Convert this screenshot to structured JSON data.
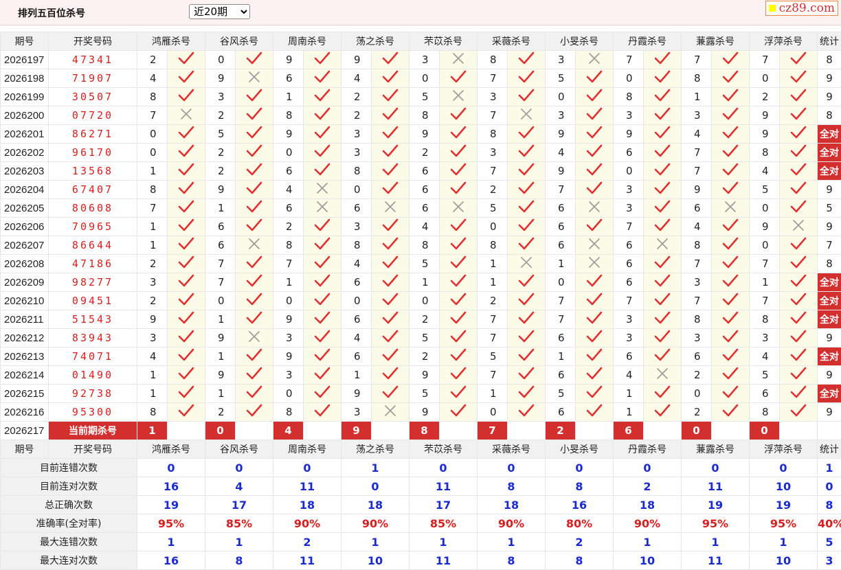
{
  "header": {
    "title": "排列五百位杀号",
    "range": "近20期",
    "logo": "cz89.com"
  },
  "cols": {
    "issue": "期号",
    "draw": "开奖号码",
    "stat": "统计"
  },
  "experts": [
    "鸿雁杀号",
    "谷风杀号",
    "周南杀号",
    "荡之杀号",
    "芣苡杀号",
    "采薇杀号",
    "小旻杀号",
    "丹霞杀号",
    "蒹露杀号",
    "浮萍杀号"
  ],
  "rows": [
    {
      "issue": "2026197",
      "draw": "47341",
      "kills": [
        2,
        0,
        9,
        9,
        3,
        8,
        3,
        7,
        7,
        7
      ],
      "ok": [
        1,
        1,
        1,
        1,
        0,
        1,
        0,
        1,
        1,
        1
      ],
      "total": "8"
    },
    {
      "issue": "2026198",
      "draw": "71907",
      "kills": [
        4,
        9,
        6,
        4,
        0,
        7,
        5,
        0,
        8,
        0
      ],
      "ok": [
        1,
        0,
        1,
        1,
        1,
        1,
        1,
        1,
        1,
        1
      ],
      "total": "9"
    },
    {
      "issue": "2026199",
      "draw": "30507",
      "kills": [
        8,
        3,
        1,
        2,
        5,
        3,
        0,
        8,
        1,
        2
      ],
      "ok": [
        1,
        1,
        1,
        1,
        0,
        1,
        1,
        1,
        1,
        1
      ],
      "total": "9"
    },
    {
      "issue": "2026200",
      "draw": "07720",
      "kills": [
        7,
        2,
        8,
        2,
        8,
        7,
        3,
        3,
        3,
        9
      ],
      "ok": [
        0,
        1,
        1,
        1,
        1,
        0,
        1,
        1,
        1,
        1
      ],
      "total": "8"
    },
    {
      "issue": "2026201",
      "draw": "86271",
      "kills": [
        0,
        5,
        9,
        3,
        9,
        8,
        9,
        9,
        4,
        9
      ],
      "ok": [
        1,
        1,
        1,
        1,
        1,
        1,
        1,
        1,
        1,
        1
      ],
      "total": "全对"
    },
    {
      "issue": "2026202",
      "draw": "96170",
      "kills": [
        0,
        2,
        0,
        3,
        2,
        3,
        4,
        6,
        7,
        8
      ],
      "ok": [
        1,
        1,
        1,
        1,
        1,
        1,
        1,
        1,
        1,
        1
      ],
      "total": "全对"
    },
    {
      "issue": "2026203",
      "draw": "13568",
      "kills": [
        1,
        2,
        6,
        8,
        6,
        7,
        9,
        0,
        7,
        4
      ],
      "ok": [
        1,
        1,
        1,
        1,
        1,
        1,
        1,
        1,
        1,
        1
      ],
      "total": "全对"
    },
    {
      "issue": "2026204",
      "draw": "67407",
      "kills": [
        8,
        9,
        4,
        0,
        6,
        2,
        7,
        3,
        9,
        5
      ],
      "ok": [
        1,
        1,
        0,
        1,
        1,
        1,
        1,
        1,
        1,
        1
      ],
      "total": "9"
    },
    {
      "issue": "2026205",
      "draw": "80608",
      "kills": [
        7,
        1,
        6,
        6,
        6,
        5,
        6,
        3,
        6,
        0
      ],
      "ok": [
        1,
        1,
        0,
        0,
        0,
        1,
        0,
        1,
        0,
        1
      ],
      "total": "5"
    },
    {
      "issue": "2026206",
      "draw": "70965",
      "kills": [
        1,
        6,
        2,
        3,
        4,
        0,
        6,
        7,
        4,
        9
      ],
      "ok": [
        1,
        1,
        1,
        1,
        1,
        1,
        1,
        1,
        1,
        0
      ],
      "total": "9"
    },
    {
      "issue": "2026207",
      "draw": "86644",
      "kills": [
        1,
        6,
        8,
        8,
        8,
        8,
        6,
        6,
        8,
        0
      ],
      "ok": [
        1,
        0,
        1,
        1,
        1,
        1,
        0,
        0,
        1,
        1
      ],
      "total": "7"
    },
    {
      "issue": "2026208",
      "draw": "47186",
      "kills": [
        2,
        7,
        7,
        4,
        5,
        1,
        1,
        6,
        7,
        7
      ],
      "ok": [
        1,
        1,
        1,
        1,
        1,
        0,
        0,
        1,
        1,
        1
      ],
      "total": "8"
    },
    {
      "issue": "2026209",
      "draw": "98277",
      "kills": [
        3,
        7,
        1,
        6,
        1,
        1,
        0,
        6,
        3,
        1
      ],
      "ok": [
        1,
        1,
        1,
        1,
        1,
        1,
        1,
        1,
        1,
        1
      ],
      "total": "全对"
    },
    {
      "issue": "2026210",
      "draw": "09451",
      "kills": [
        2,
        0,
        0,
        0,
        0,
        2,
        7,
        7,
        7,
        7
      ],
      "ok": [
        1,
        1,
        1,
        1,
        1,
        1,
        1,
        1,
        1,
        1
      ],
      "total": "全对"
    },
    {
      "issue": "2026211",
      "draw": "51543",
      "kills": [
        9,
        1,
        9,
        6,
        2,
        7,
        7,
        3,
        8,
        8
      ],
      "ok": [
        1,
        1,
        1,
        1,
        1,
        1,
        1,
        1,
        1,
        1
      ],
      "total": "全对"
    },
    {
      "issue": "2026212",
      "draw": "83943",
      "kills": [
        3,
        9,
        3,
        4,
        5,
        7,
        6,
        3,
        3,
        3
      ],
      "ok": [
        1,
        0,
        1,
        1,
        1,
        1,
        1,
        1,
        1,
        1
      ],
      "total": "9"
    },
    {
      "issue": "2026213",
      "draw": "74071",
      "kills": [
        4,
        1,
        9,
        6,
        2,
        5,
        1,
        6,
        6,
        4
      ],
      "ok": [
        1,
        1,
        1,
        1,
        1,
        1,
        1,
        1,
        1,
        1
      ],
      "total": "全对"
    },
    {
      "issue": "2026214",
      "draw": "01490",
      "kills": [
        1,
        9,
        3,
        1,
        9,
        7,
        6,
        4,
        2,
        5
      ],
      "ok": [
        1,
        1,
        1,
        1,
        1,
        1,
        1,
        0,
        1,
        1
      ],
      "total": "9"
    },
    {
      "issue": "2026215",
      "draw": "92738",
      "kills": [
        1,
        1,
        0,
        9,
        5,
        1,
        5,
        1,
        0,
        6
      ],
      "ok": [
        1,
        1,
        1,
        1,
        1,
        1,
        1,
        1,
        1,
        1
      ],
      "total": "全对"
    },
    {
      "issue": "2026216",
      "draw": "95300",
      "kills": [
        8,
        2,
        8,
        3,
        9,
        0,
        6,
        1,
        2,
        8
      ],
      "ok": [
        1,
        1,
        1,
        0,
        1,
        1,
        1,
        1,
        1,
        1
      ],
      "total": "9"
    }
  ],
  "current": {
    "issue": "2026217",
    "label": "当前期杀号",
    "kills": [
      "1",
      "0",
      "4",
      "9",
      "8",
      "7",
      "2",
      "6",
      "0",
      "0"
    ]
  },
  "stats": [
    {
      "label": "目前连错次数",
      "values": [
        "0",
        "0",
        "0",
        "1",
        "0",
        "0",
        "0",
        "0",
        "0",
        "0"
      ],
      "total": "1"
    },
    {
      "label": "目前连对次数",
      "values": [
        "16",
        "4",
        "11",
        "0",
        "11",
        "8",
        "8",
        "2",
        "11",
        "10"
      ],
      "total": "0"
    },
    {
      "label": "总正确次数",
      "values": [
        "19",
        "17",
        "18",
        "18",
        "17",
        "18",
        "16",
        "18",
        "19",
        "19"
      ],
      "total": "8"
    },
    {
      "label": "准确率(全对率)",
      "values": [
        "95%",
        "85%",
        "90%",
        "90%",
        "85%",
        "90%",
        "80%",
        "90%",
        "95%",
        "95%"
      ],
      "total": "40%",
      "red": true
    },
    {
      "label": "最大连错次数",
      "values": [
        "1",
        "1",
        "2",
        "1",
        "1",
        "1",
        "2",
        "1",
        "1",
        "1"
      ],
      "total": "5"
    },
    {
      "label": "最大连对次数",
      "values": [
        "16",
        "8",
        "11",
        "10",
        "11",
        "8",
        "8",
        "10",
        "11",
        "10"
      ],
      "total": "3"
    }
  ],
  "colors": {
    "accent": "#d32f2f",
    "check": "#e03030",
    "cross": "#9a9a9a",
    "stat": "#1a2ad0"
  }
}
